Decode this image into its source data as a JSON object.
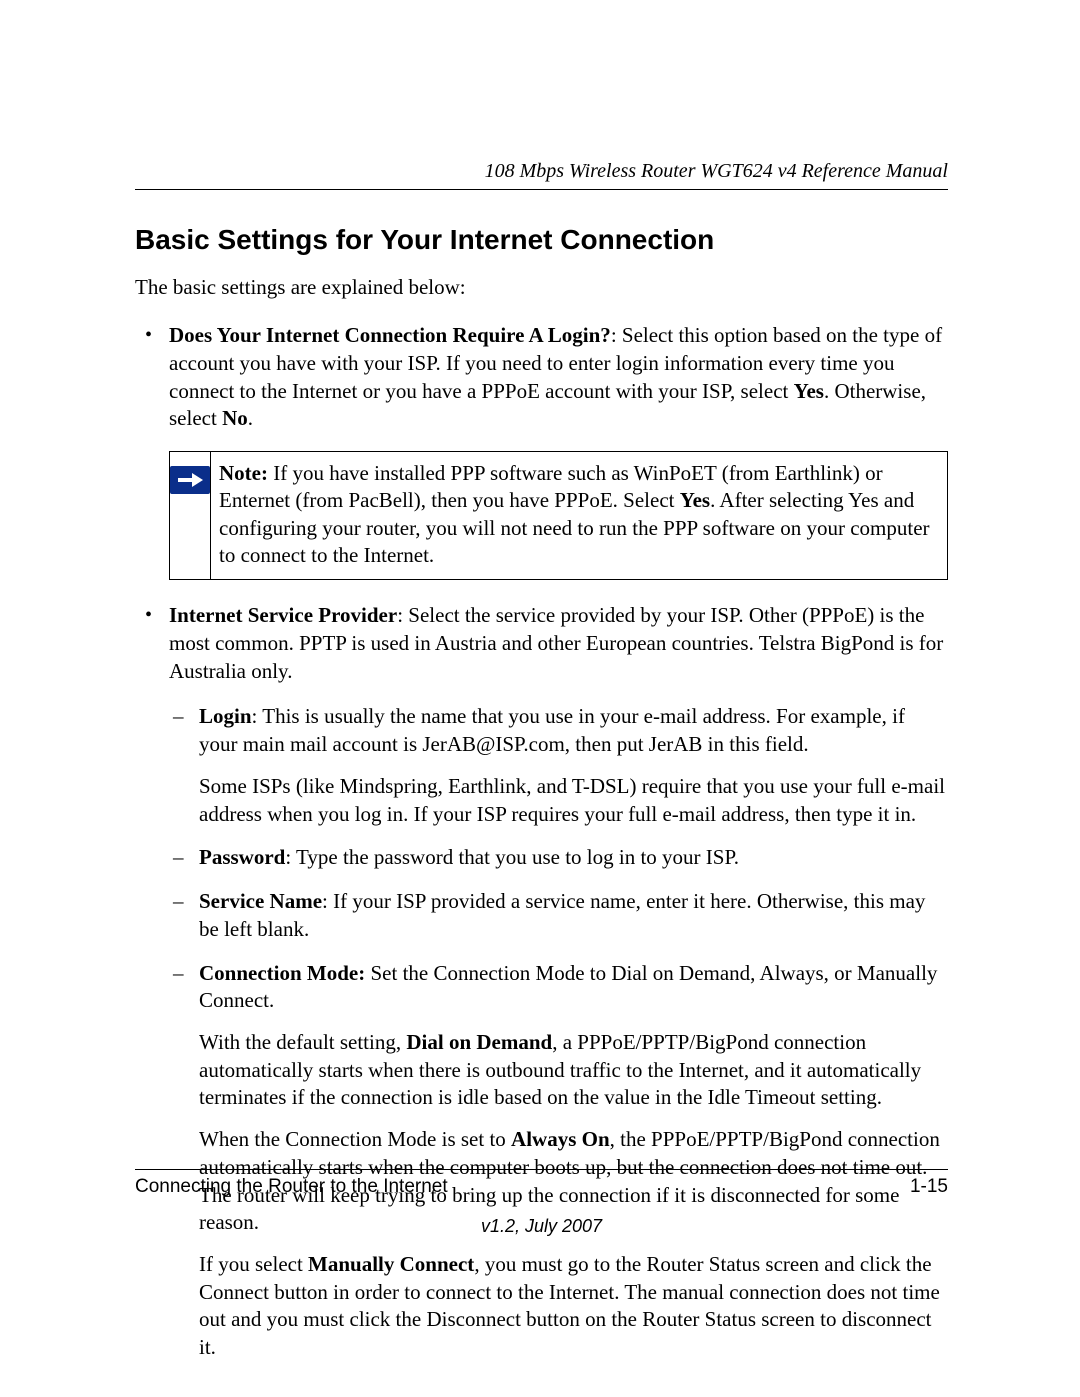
{
  "header": {
    "running_title": "108 Mbps Wireless Router WGT624 v4 Reference Manual"
  },
  "section": {
    "title": "Basic Settings for Your Internet Connection",
    "intro": "The basic settings are explained below:"
  },
  "bullets": {
    "login_req": {
      "label": "Does Your Internet Connection Require A Login?",
      "text_a": ": Select this option based on the type of account you have with your ISP. If you need to enter login information every time you connect to the Internet or you have a PPPoE account with your ISP, select ",
      "bold_yes": "Yes",
      "text_b": ". Otherwise, select ",
      "bold_no": "No",
      "text_c": "."
    },
    "isp": {
      "label": "Internet Service Provider",
      "text": ": Select the service provided by your ISP. Other (PPPoE) is the most common. PPTP is used in Austria and other European countries. Telstra BigPond is for Australia only."
    },
    "sub": {
      "login": {
        "label": "Login",
        "text": ": This is usually the name that you use in your e-mail address. For example, if your main mail account is JerAB@ISP.com, then put JerAB in this field.",
        "para2": "Some ISPs (like Mindspring, Earthlink, and T-DSL) require that you use your full e-mail address when you log in. If your ISP requires your full e-mail address, then type it in."
      },
      "password": {
        "label": "Password",
        "text": ": Type the password that you use to log in to your ISP."
      },
      "service_name": {
        "label": "Service Name",
        "text": ": If your ISP provided a service name, enter it here. Otherwise, this may be left blank."
      },
      "conn_mode": {
        "label": "Connection Mode:",
        "text": " Set the Connection Mode to Dial on Demand, Always, or Manually Connect.",
        "p2_a": "With the default setting, ",
        "p2_bold": "Dial on Demand",
        "p2_b": ", a PPPoE/PPTP/BigPond connection automatically starts when there is outbound traffic to the Internet, and it automatically terminates if the connection is idle based on the value in the Idle Timeout setting.",
        "p3_a": "When the Connection Mode is set to ",
        "p3_bold": "Always On",
        "p3_b": ", the PPPoE/PPTP/BigPond connection automatically starts when the computer boots up, but the connection does not time out. The router will keep trying to bring up the connection if it is disconnected for some reason.",
        "p4_a": "If you select ",
        "p4_bold": "Manually Connect",
        "p4_b": ", you must go to the Router Status screen and click the Connect button in order to connect to the Internet. The manual connection does not time out and you must click the Disconnect button on the Router Status screen to disconnect it."
      }
    }
  },
  "note": {
    "label": "Note:",
    "text_a": " If you have installed PPP software such as WinPoET (from Earthlink) or Enternet (from PacBell), then you have PPPoE. Select ",
    "bold_yes": "Yes",
    "text_b": ". After selecting Yes and configuring your router, you will not need to run the PPP software on your computer to connect to the Internet."
  },
  "footer": {
    "chapter": "Connecting the Router to the Internet",
    "page": "1-15",
    "version": "v1.2, July 2007"
  }
}
